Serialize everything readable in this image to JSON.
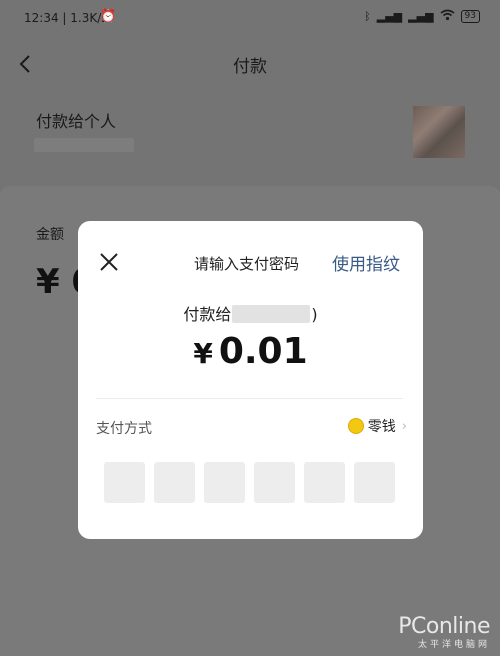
{
  "status_bar": {
    "time": "12:34",
    "net_speed": "1.3K/s",
    "battery": "93"
  },
  "nav": {
    "title": "付款"
  },
  "payee": {
    "label": "付款给个人"
  },
  "amount_section": {
    "label": "金额",
    "value_prefix": "¥ 0"
  },
  "dialog": {
    "title": "请输入支付密码",
    "fingerprint_link": "使用指纹",
    "pay_to_prefix": "付款给",
    "pay_to_suffix": ")",
    "currency": "¥",
    "amount": "0.01",
    "method_label": "支付方式",
    "method_value": "零钱",
    "password_slots": 6
  },
  "watermark": {
    "brand": "PConline",
    "sub": "太平洋电脑网"
  },
  "icons": {
    "back": "chevron-left-icon",
    "close": "close-icon",
    "coin": "coin-icon",
    "chevron": "chevron-right-icon",
    "alarm": "alarm-icon",
    "bluetooth": "bluetooth-icon",
    "wifi": "wifi-icon"
  },
  "colors": {
    "link": "#3a5a86",
    "overlay": "#747474",
    "coin": "#f2c811"
  }
}
